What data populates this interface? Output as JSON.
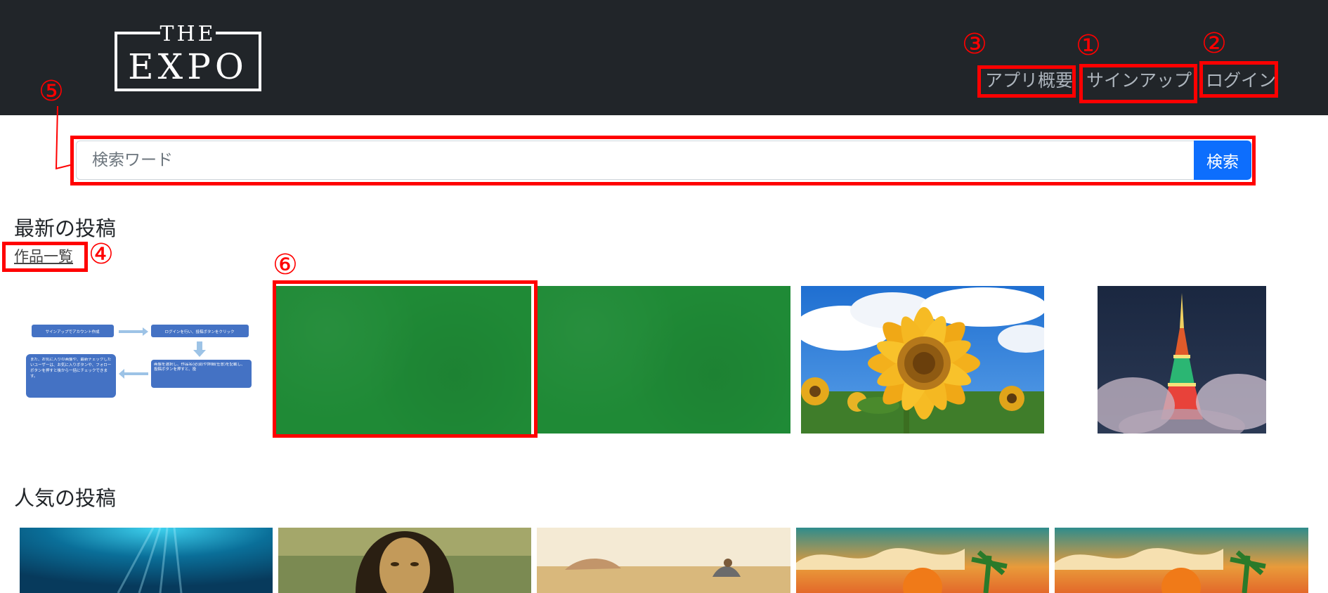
{
  "header": {
    "logo_top": "THE",
    "logo_bottom": "EXPO",
    "nav": {
      "about": "アプリ概要",
      "signup": "サインアップ",
      "login": "ログイン"
    }
  },
  "search": {
    "placeholder": "検索ワード",
    "button": "検索"
  },
  "latest": {
    "title": "最新の投稿",
    "works_link": "作品一覧",
    "flowchart": {
      "step1": "サインアップでアカウント作成",
      "step2": "ログインを行い、投稿ボタンをクリック",
      "step3": "画像を選択し、作品名(必須)や詳細(任意)を記載し、投稿ボタンを押すと、投",
      "step4": "また、お気に入りの画像や、最新チェックしたいユーザーは、お気に入りボタンや、フォローボタンを押すと後から一括にチェックできます。"
    }
  },
  "popular": {
    "title": "人気の投稿"
  },
  "annotations": [
    "①",
    "②",
    "③",
    "④",
    "⑤",
    "⑥"
  ],
  "colors": {
    "navbar": "#212529",
    "accent": "#0d6efd",
    "annotation": "#ff0000"
  }
}
